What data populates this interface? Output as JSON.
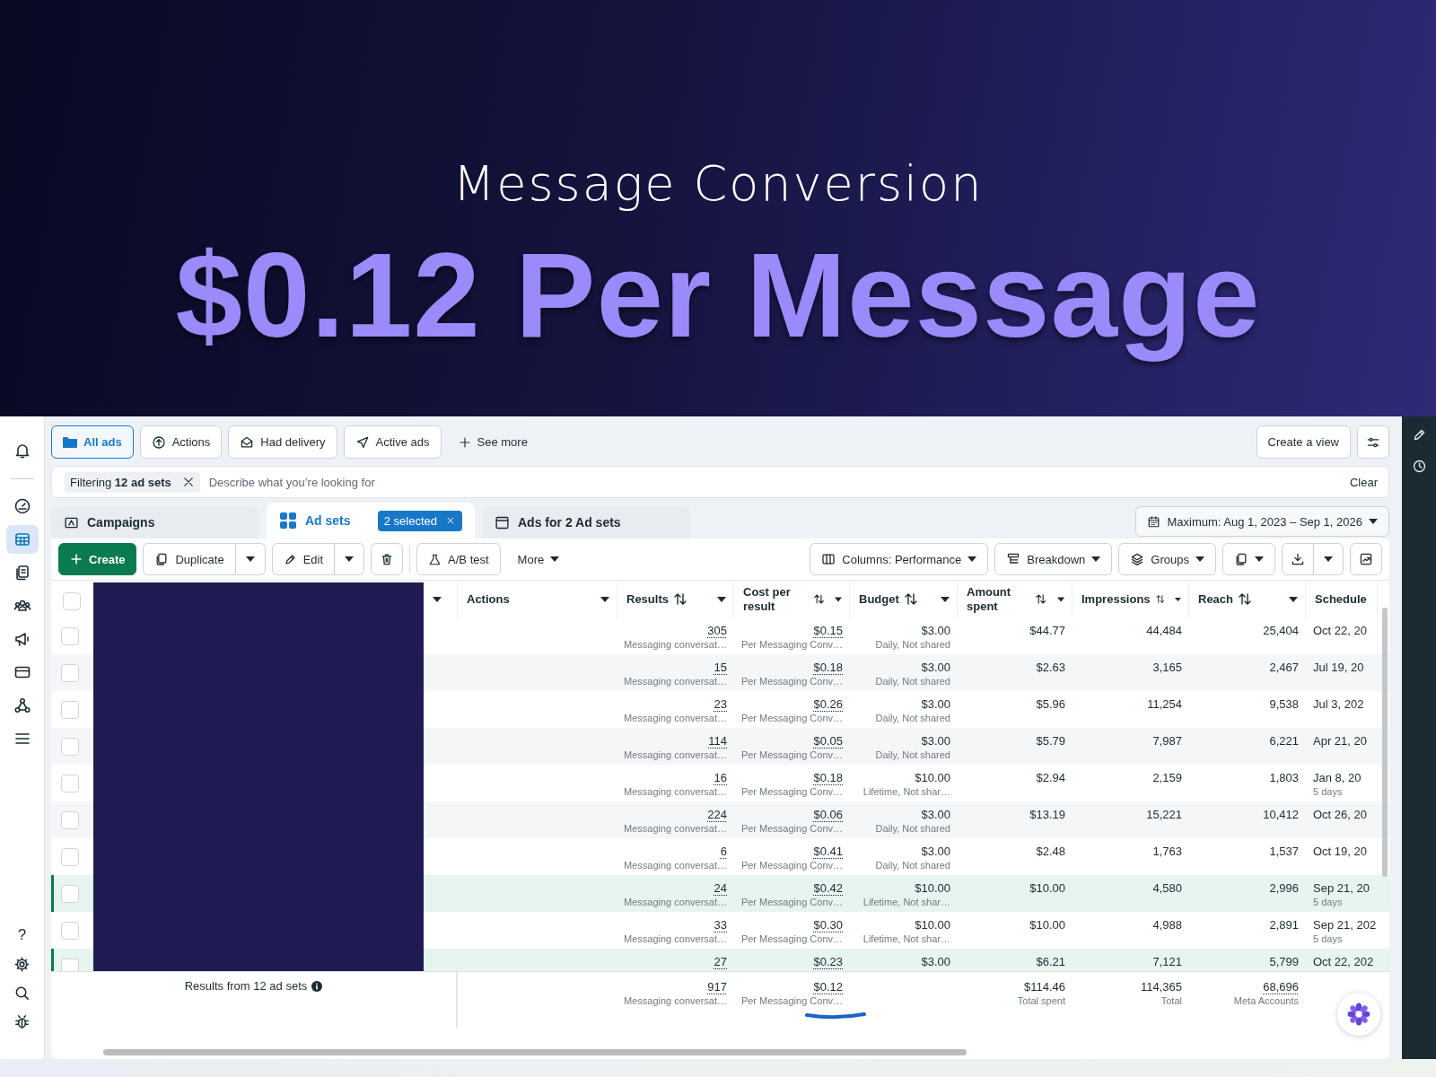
{
  "hero": {
    "subtitle": "Message Conversion",
    "headline": "$0.12 Per Message"
  },
  "nav_items": [
    {
      "selected": false
    },
    {
      "selected": false
    },
    {
      "selected": true
    },
    {
      "selected": false
    },
    {
      "selected": false
    },
    {
      "selected": false
    },
    {
      "selected": false
    },
    {
      "selected": false
    },
    {
      "selected": false
    }
  ],
  "help_label": "?",
  "view_tabs": [
    {
      "label": "All ads",
      "selected": true
    },
    {
      "label": "Actions",
      "selected": false
    },
    {
      "label": "Had delivery",
      "selected": false
    },
    {
      "label": "Active ads",
      "selected": false
    }
  ],
  "see_more": "See more",
  "create_view": "Create a view",
  "filter": {
    "chip": "Filtering **12 ad sets**",
    "placeholder": "Describe what you’re looking for",
    "clear": "Clear"
  },
  "level_tabs": [
    {
      "label": "Campaigns",
      "selected": false
    },
    {
      "label": "Ad sets",
      "selected": true,
      "badge": "2 selected"
    },
    {
      "label": "Ads for 2 Ad sets",
      "selected": false
    }
  ],
  "date_range": "Maximum: Aug 1, 2023 – Sep 1, 2026",
  "toolbar": {
    "create": "Create",
    "duplicate": "Duplicate",
    "edit": "Edit",
    "ab_test": "A/B test",
    "more": "More",
    "columns": "Columns: Performance",
    "breakdown": "Breakdown",
    "groups": "Groups"
  },
  "table": {
    "header_checked": false,
    "columns": [
      {
        "label": "Actions",
        "sortable": false
      },
      {
        "label": "Results",
        "sortable": true
      },
      {
        "label": "Cost per result",
        "sortable": true
      },
      {
        "label": "Budget",
        "sortable": true
      },
      {
        "label": "Amount spent",
        "sortable": true
      },
      {
        "label": "Impressions",
        "sortable": true
      },
      {
        "label": "Reach",
        "sortable": true
      },
      {
        "label": "Schedule",
        "sortable": false
      }
    ],
    "rows": [
      {
        "selected": false,
        "results": "305",
        "results_label": "Messaging conversat…",
        "cost": "$0.15",
        "cost_label": "Per Messaging Conv…",
        "budget": "$3.00",
        "budget_label": "Daily, Not shared",
        "amount_spent": "$44.77",
        "impressions": "44,484",
        "reach": "25,404",
        "schedule": "Oct 22, 20"
      },
      {
        "selected": false,
        "results": "15",
        "results_label": "Messaging conversat…",
        "cost": "$0.18",
        "cost_label": "Per Messaging Conv…",
        "budget": "$3.00",
        "budget_label": "Daily, Not shared",
        "amount_spent": "$2.63",
        "impressions": "3,165",
        "reach": "2,467",
        "schedule": "Jul 19, 20"
      },
      {
        "selected": false,
        "results": "23",
        "results_label": "Messaging conversat…",
        "cost": "$0.26",
        "cost_label": "Per Messaging Conv…",
        "budget": "$3.00",
        "budget_label": "Daily, Not shared",
        "amount_spent": "$5.96",
        "impressions": "11,254",
        "reach": "9,538",
        "schedule": "Jul 3, 202"
      },
      {
        "selected": false,
        "results": "114",
        "results_label": "Messaging conversat…",
        "cost": "$0.05",
        "cost_label": "Per Messaging Conv…",
        "budget": "$3.00",
        "budget_label": "Daily, Not shared",
        "amount_spent": "$5.79",
        "impressions": "7,987",
        "reach": "6,221",
        "schedule": "Apr 21, 20"
      },
      {
        "selected": false,
        "results": "16",
        "results_label": "Messaging conversat…",
        "cost": "$0.18",
        "cost_label": "Per Messaging Conv…",
        "budget": "$10.00",
        "budget_label": "Lifetime, Not shar…",
        "amount_spent": "$2.94",
        "impressions": "2,159",
        "reach": "1,803",
        "schedule": "Jan 8, 20",
        "schedule_note": "5 days"
      },
      {
        "selected": false,
        "results": "224",
        "results_label": "Messaging conversat…",
        "cost": "$0.06",
        "cost_label": "Per Messaging Conv…",
        "budget": "$3.00",
        "budget_label": "Daily, Not shared",
        "amount_spent": "$13.19",
        "impressions": "15,221",
        "reach": "10,412",
        "schedule": "Oct 26, 20"
      },
      {
        "selected": false,
        "results": "6",
        "results_label": "Messaging conversat…",
        "cost": "$0.41",
        "cost_label": "Per Messaging Conv…",
        "budget": "$3.00",
        "budget_label": "Daily, Not shared",
        "amount_spent": "$2.48",
        "impressions": "1,763",
        "reach": "1,537",
        "schedule": "Oct 19, 20"
      },
      {
        "selected": true,
        "results": "24",
        "results_label": "Messaging conversat…",
        "cost": "$0.42",
        "cost_label": "Per Messaging Conv…",
        "budget": "$10.00",
        "budget_label": "Lifetime, Not shar…",
        "amount_spent": "$10.00",
        "impressions": "4,580",
        "reach": "2,996",
        "schedule": "Sep 21, 20",
        "schedule_note": "5 days"
      },
      {
        "selected": false,
        "results": "33",
        "results_label": "Messaging conversat…",
        "cost": "$0.30",
        "cost_label": "Per Messaging Conv…",
        "budget": "$10.00",
        "budget_label": "Lifetime, Not shar…",
        "amount_spent": "$10.00",
        "impressions": "4,988",
        "reach": "2,891",
        "schedule": "Sep 21, 202",
        "schedule_note": "5 days"
      },
      {
        "selected": true,
        "results": "27",
        "cost": "$0.23",
        "budget": "$3.00",
        "amount_spent": "$6.21",
        "impressions": "7,121",
        "reach": "5,799",
        "schedule": "Oct 22, 202"
      }
    ],
    "footer": {
      "label": "Results from 12 ad sets",
      "results": "917",
      "results_label": "Messaging conversat…",
      "cost": "$0.12",
      "cost_label": "Per Messaging Conv…",
      "amount_spent": "$114.46",
      "amount_label": "Total spent",
      "impressions": "114,365",
      "impressions_label": "Total",
      "reach": "68,696",
      "reach_label": "Meta Accounts"
    }
  }
}
